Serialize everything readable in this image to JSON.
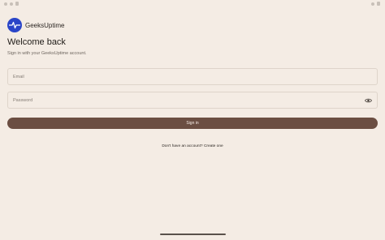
{
  "app": {
    "name": "GeeksUptime",
    "brand_color": "#2a45c8",
    "logo_icon": "pulse-icon"
  },
  "login": {
    "title": "Welcome back",
    "subtitle": "Sign in with your GeeksUptime account.",
    "email_placeholder": "Email",
    "email_value": "",
    "password_placeholder": "Password",
    "password_value": "",
    "password_toggle_icon": "eye-icon",
    "signin_label": "Sign in",
    "signin_color": "#6b4e42",
    "no_account_text": "Don't have an account?",
    "create_link": "Create one"
  }
}
